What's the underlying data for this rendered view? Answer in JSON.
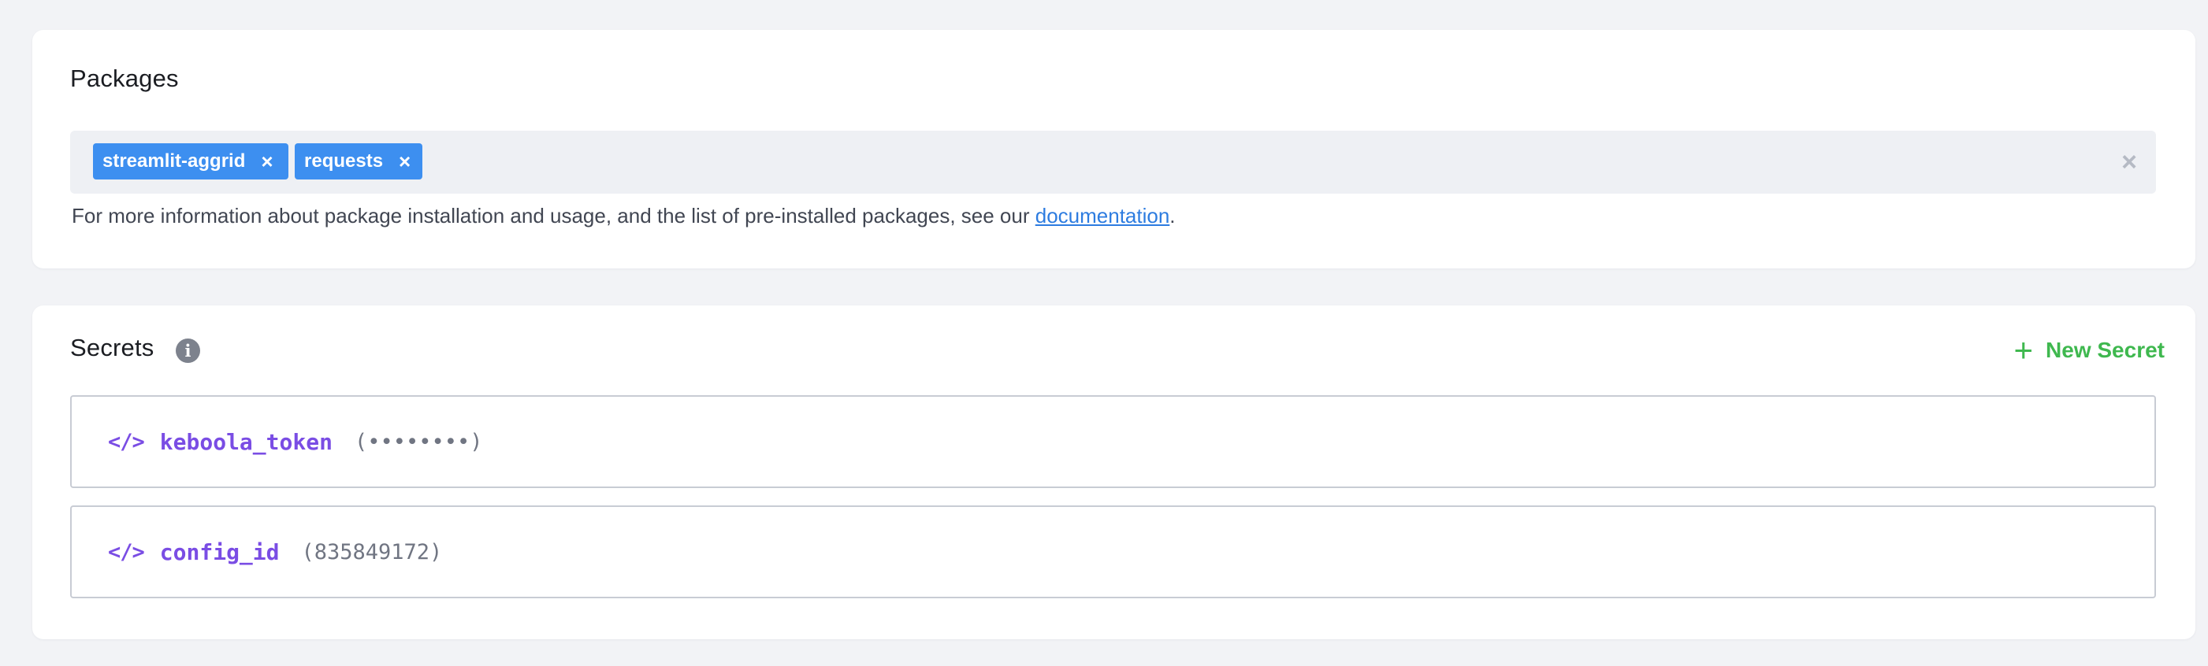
{
  "packages": {
    "title": "Packages",
    "tags": [
      {
        "label": "streamlit-aggrid",
        "remove": "×"
      },
      {
        "label": "requests",
        "remove": "×"
      }
    ],
    "clear_all": "×",
    "helper_prefix": "For more information about package installation and usage, and the list of pre-installed packages, see our ",
    "helper_link": "documentation",
    "helper_suffix": "."
  },
  "secrets": {
    "title": "Secrets",
    "info_icon": "info-icon",
    "new_secret_icon": "+",
    "new_secret_label": "New Secret",
    "rows": [
      {
        "icon": "</>",
        "name": "keboola_token",
        "value": "(••••••••)"
      },
      {
        "icon": "</>",
        "name": "config_id",
        "value": "(835849172)"
      }
    ]
  },
  "colors": {
    "page_background": "#f2f3f6",
    "tag_blue": "#3d8ff0",
    "link_blue": "#2d7ce0",
    "accent_green": "#3fb84f",
    "secret_purple": "#7a4de4"
  }
}
